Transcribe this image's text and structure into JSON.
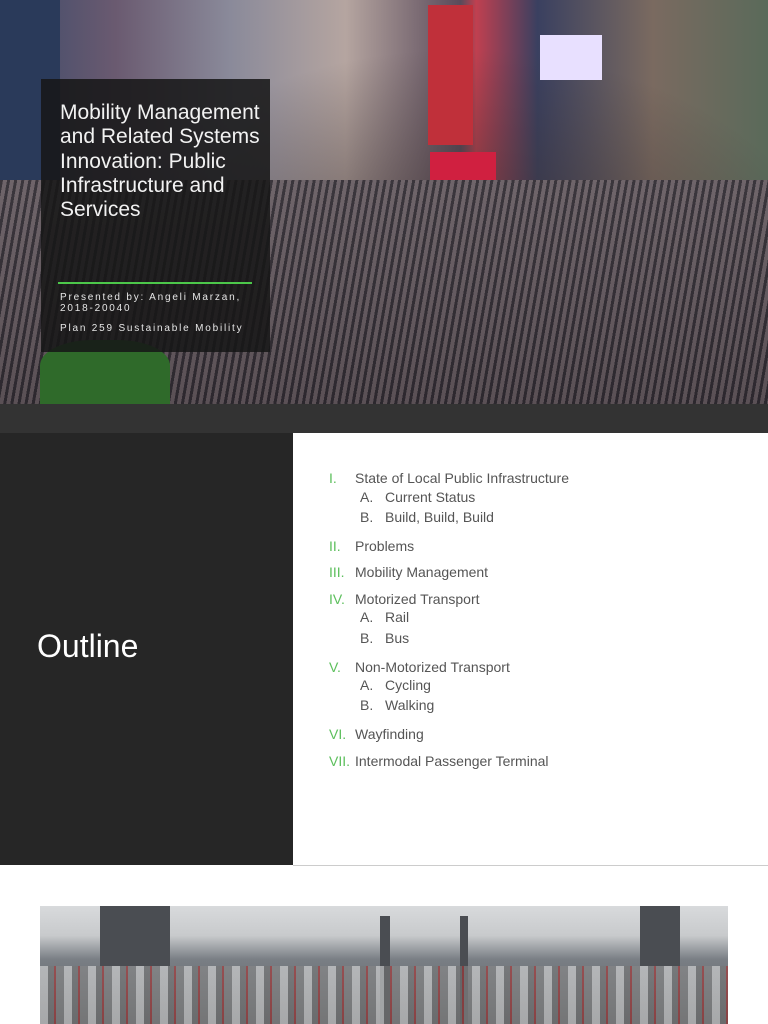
{
  "slide1": {
    "title": "Mobility Management and Related Systems Innovation: Public Infrastructure and Services",
    "presenter": "Presented by: Angeli Marzan, 2018-20040",
    "course": "Plan 259 Sustainable Mobility"
  },
  "slide2": {
    "heading": "Outline",
    "items": [
      {
        "num": "I.",
        "label": "State of Local Public Infrastructure",
        "subs": [
          {
            "l": "A.",
            "t": "Current Status"
          },
          {
            "l": "B.",
            "t": "Build, Build, Build"
          }
        ]
      },
      {
        "num": "II.",
        "label": "Problems"
      },
      {
        "num": "III.",
        "label": "Mobility Management"
      },
      {
        "num": "IV.",
        "label": "Motorized Transport",
        "subs": [
          {
            "l": "A.",
            "t": "Rail"
          },
          {
            "l": "B.",
            "t": "Bus"
          }
        ]
      },
      {
        "num": "V.",
        "label": "Non-Motorized Transport",
        "subs": [
          {
            "l": "A.",
            "t": "Cycling"
          },
          {
            "l": "B.",
            "t": "Walking"
          }
        ]
      },
      {
        "num": "VI.",
        "label": "Wayfinding"
      },
      {
        "num": "VII.",
        "label": "Intermodal Passenger Terminal"
      }
    ]
  },
  "colors": {
    "accent": "#4cc74a",
    "dark_panel": "#262626"
  }
}
